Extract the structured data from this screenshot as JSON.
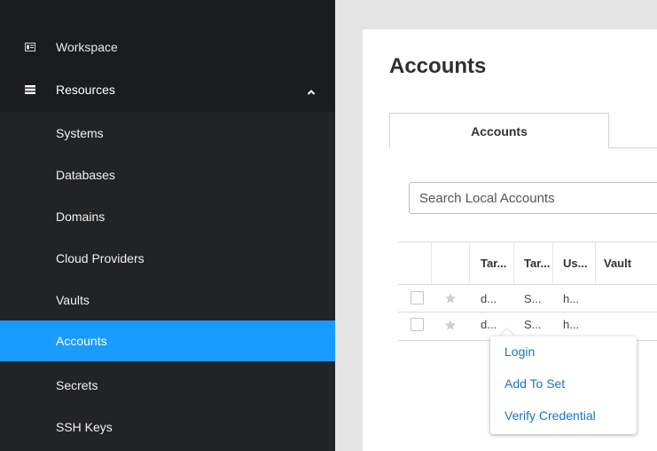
{
  "sidebar": {
    "workspace_label": "Workspace",
    "resources_label": "Resources",
    "items": [
      {
        "label": "Systems"
      },
      {
        "label": "Databases"
      },
      {
        "label": "Domains"
      },
      {
        "label": "Cloud Providers"
      },
      {
        "label": "Vaults"
      },
      {
        "label": "Accounts",
        "active": true
      },
      {
        "label": "Secrets"
      },
      {
        "label": "SSH Keys"
      }
    ],
    "active_color": "#1a9bff"
  },
  "main": {
    "title": "Accounts",
    "tab_label": "Accounts",
    "search_placeholder": "Search Local Accounts",
    "columns": [
      "Tar...",
      "Tar...",
      "Us...",
      "Vault"
    ],
    "rows": [
      [
        "d...",
        "S...",
        "h..."
      ],
      [
        "d...",
        "S...",
        "h..."
      ]
    ]
  },
  "context_menu": {
    "items": [
      "Login",
      "Add To Set",
      "Verify Credential"
    ],
    "link_color": "#1a73c6"
  }
}
